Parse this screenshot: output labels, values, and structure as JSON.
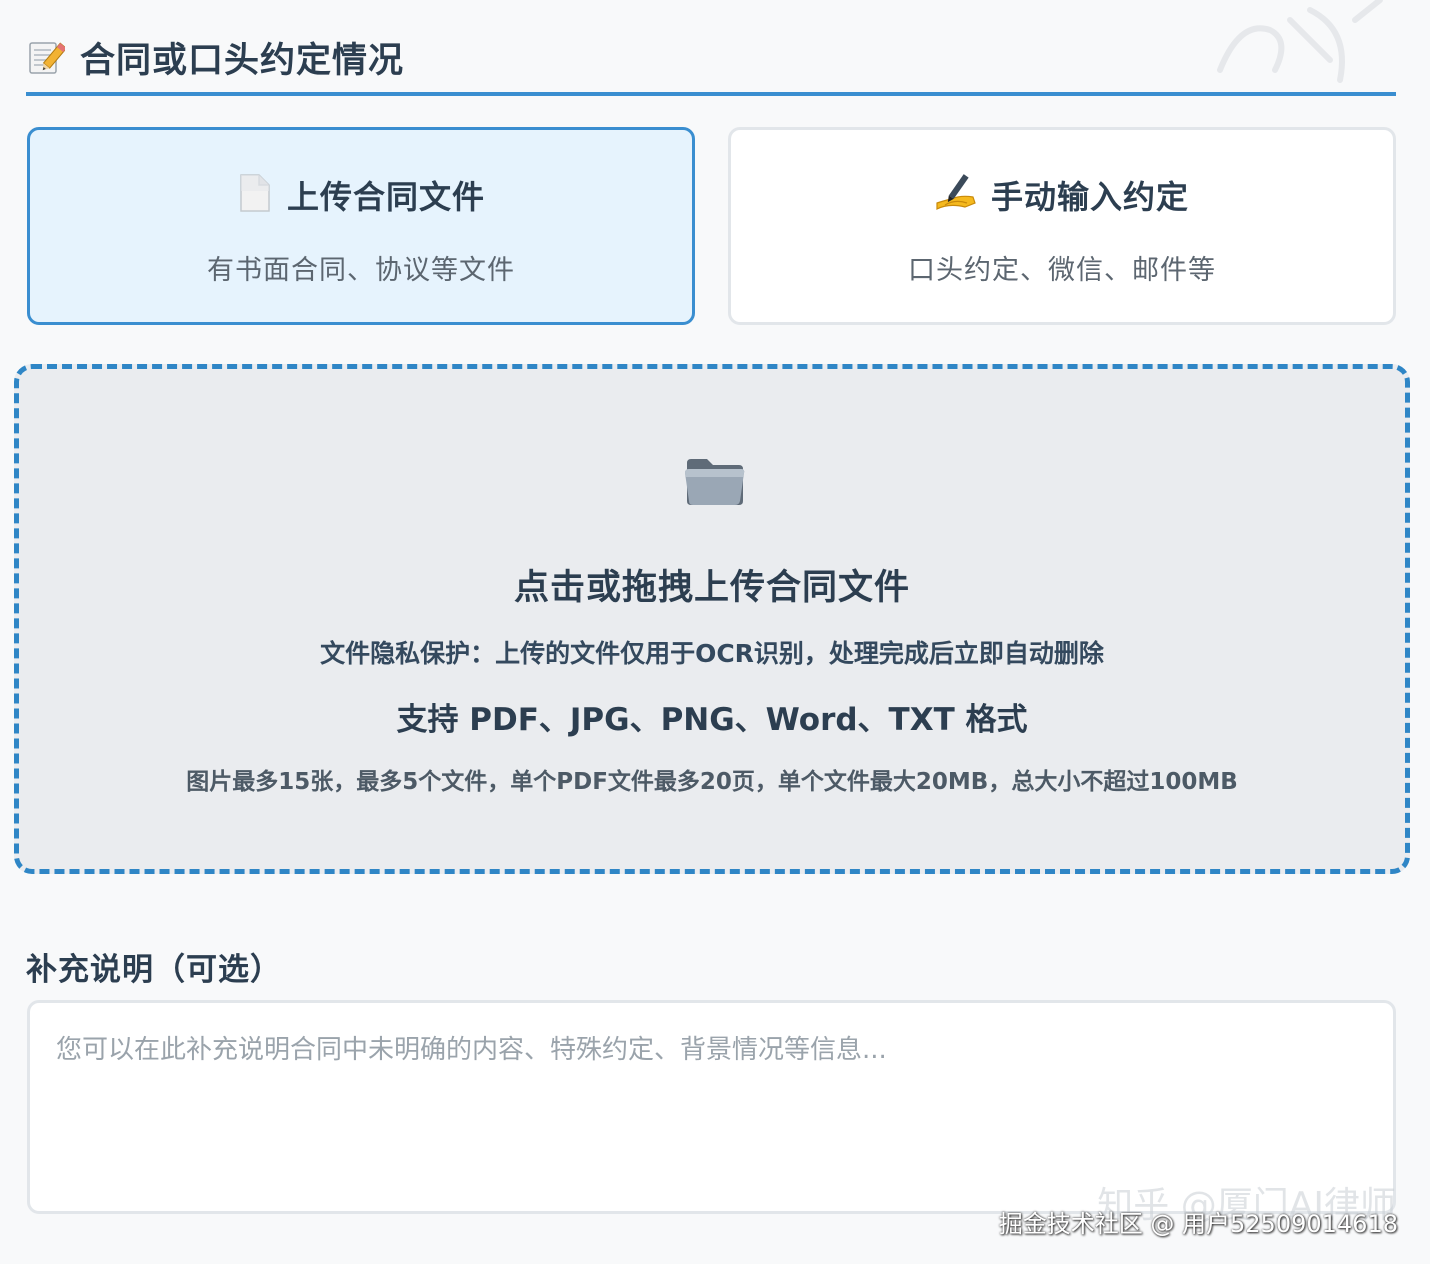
{
  "header": {
    "icon": "memo-pencil-icon",
    "title": "合同或口头约定情况"
  },
  "mode_options": [
    {
      "icon": "document-icon",
      "title": "上传合同文件",
      "description": "有书面合同、协议等文件",
      "selected": true
    },
    {
      "icon": "writing-hand-icon",
      "title": "手动输入约定",
      "description": "口头约定、微信、邮件等",
      "selected": false
    }
  ],
  "upload": {
    "icon": "folder-icon",
    "title": "点击或拖拽上传合同文件",
    "privacy_note": "文件隐私保护：上传的文件仅用于OCR识别，处理完成后立即自动删除",
    "formats": "支持 PDF、JPG、PNG、Word、TXT 格式",
    "limits": "图片最多15张，最多5个文件，单个PDF文件最多20页，单个文件最大20MB，总大小不超过100MB"
  },
  "note": {
    "label": "补充说明（可选）",
    "placeholder": "您可以在此补充说明合同中未明确的内容、特殊约定、背景情况等信息...",
    "value": ""
  },
  "watermark": {
    "line1": "知乎 @厦门AI律师",
    "line2": "掘金技术社区 @ 用户52509014618"
  },
  "colors": {
    "accent": "#3a8ed0",
    "selected_card_bg": "#e6f3fd",
    "dropzone_bg": "#eaecef",
    "dropzone_border": "#2f86c6",
    "text_primary": "#2c3e50",
    "page_bg": "#f8f9fa"
  }
}
